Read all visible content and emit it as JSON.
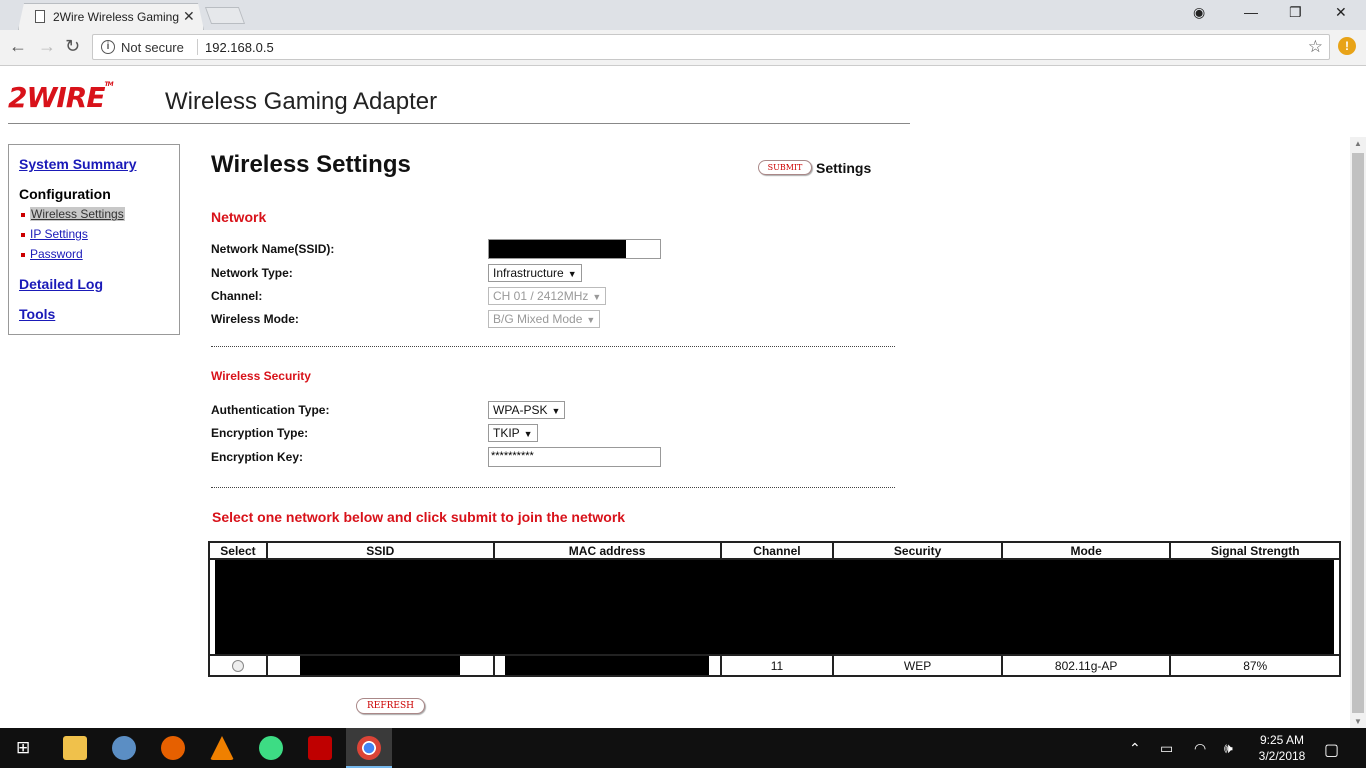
{
  "browser": {
    "tab_title": "2Wire Wireless Gaming A",
    "security_label": "Not secure",
    "url": "192.168.0.5"
  },
  "header": {
    "logo_text": "2WIRE",
    "app_title": "Wireless Gaming Adapter"
  },
  "sidebar": {
    "system_summary": "System Summary",
    "configuration": "Configuration",
    "sub_items": [
      "Wireless Settings",
      "IP Settings",
      "Password"
    ],
    "detailed_log": "Detailed Log",
    "tools": "Tools"
  },
  "main": {
    "title": "Wireless Settings",
    "submit_button": "SUBMIT",
    "submit_label": "Settings",
    "network_section": "Network",
    "labels": {
      "ssid": "Network Name(SSID):",
      "network_type": "Network Type:",
      "channel": "Channel:",
      "wireless_mode": "Wireless Mode:"
    },
    "values": {
      "ssid": "",
      "network_type": "Infrastructure",
      "channel": "CH 01 / 2412MHz",
      "wireless_mode": "B/G Mixed Mode"
    },
    "security_section": "Wireless Security",
    "security_labels": {
      "auth_type": "Authentication Type:",
      "enc_type": "Encryption Type:",
      "enc_key": "Encryption Key:"
    },
    "security_values": {
      "auth_type": "WPA-PSK",
      "enc_type": "TKIP",
      "enc_key": "**********"
    },
    "join_text": "Select one network below and click submit to join the network",
    "table": {
      "headers": [
        "Select",
        "SSID",
        "MAC address",
        "Channel",
        "Security",
        "Mode",
        "Signal Strength"
      ],
      "visible_row": {
        "channel": "11",
        "security": "WEP",
        "mode": "802.11g-AP",
        "signal": "87%"
      }
    },
    "refresh_button": "REFRESH"
  },
  "taskbar": {
    "time": "9:25 AM",
    "date": "3/2/2018",
    "icons": [
      "file-explorer-icon",
      "network-icon",
      "firefox-icon",
      "vlc-icon",
      "android-icon",
      "filezilla-icon",
      "chrome-icon"
    ]
  }
}
